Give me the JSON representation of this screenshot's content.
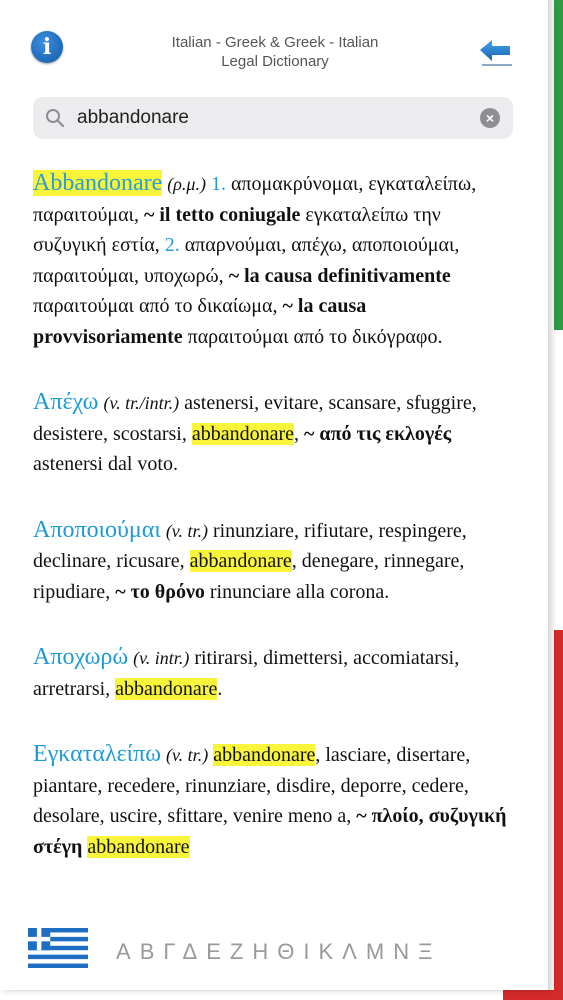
{
  "header": {
    "title_line1": "Italian - Greek & Greek - Italian",
    "title_line2": "Legal Dictionary",
    "info_icon": "info-icon",
    "back_icon": "back-arrow-icon"
  },
  "search": {
    "value": "abbandonare",
    "icon": "search-icon",
    "clear_icon": "clear-icon"
  },
  "entries": [
    {
      "headword": "Abbandonare",
      "pos": "(ρ.μ.)",
      "num1": "1.",
      "t1": " απομακρύνομαι, εγκαταλείπω, παραιτούμαι, ",
      "b1": "~ il tetto coniugale",
      "t2": " εγκαταλείπω την συζυγική εστία, ",
      "num2": "2.",
      "t3": " απαρνούμαι, απέχω, αποποιούμαι, παραιτούμαι, υποχωρώ, ",
      "b2": "~ la causa definitivamente",
      "t4": " παραιτούμαι από το δικαίωμα, ",
      "b3": "~ la causa provvisoriamente",
      "t5": " παραιτούμαι από το δικόγραφο."
    },
    {
      "headword": "Απέχω",
      "pos": "(v. tr./intr.)",
      "t1": " astenersi, evitare, scansare, sfuggire, desistere, scostarsi, ",
      "hl": "abbandonare",
      "t2": ", ",
      "b1": "~ από τις εκλογές",
      "t3": " astenersi dal voto."
    },
    {
      "headword": "Αποποιούμαι",
      "pos": "(v. tr.)",
      "t1": " rinunziare, rifiutare, respingere, declinare, ricusare, ",
      "hl": "abbandonare",
      "t2": ", denegare, rinnegare, ripudiare, ",
      "b1": "~ το θρόνο",
      "t3": " rinunciare alla corona."
    },
    {
      "headword": "Αποχωρώ",
      "pos": "(v. intr.)",
      "t1": " ritirarsi, dimettersi, accomiatarsi, arretrarsi, ",
      "hl": "abbandonare",
      "t2": "."
    },
    {
      "headword": "Εγκαταλείπω",
      "pos": "(v. tr.)",
      "hl1": "abbandonare",
      "t1": ", lasciare, disertare, piantare, recedere, rinunziare, disdire, deporre, cedere, desolare, uscire, sfittare, venire meno a, ",
      "b1": "~ πλοίο, συζυγική στέγη",
      "hl2": "abbandonare"
    }
  ],
  "footer": {
    "flag_icon": "greek-flag-icon",
    "alphabet": [
      "Α",
      "Β",
      "Γ",
      "Δ",
      "Ε",
      "Ζ",
      "Η",
      "Θ",
      "Ι",
      "Κ",
      "Λ",
      "Μ",
      "Ν",
      "Ξ"
    ]
  },
  "colors": {
    "accent_blue": "#1e9bd7",
    "highlight_yellow": "#f8f53a",
    "flag_green": "#2e9a46",
    "flag_red": "#d42a2a"
  }
}
